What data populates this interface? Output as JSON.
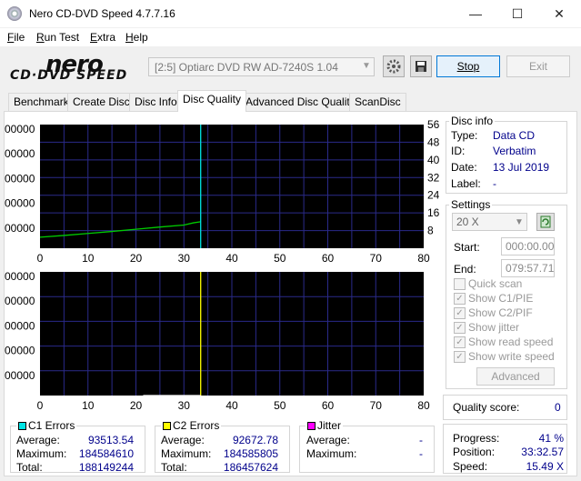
{
  "window": {
    "title": "Nero CD-DVD Speed 4.7.7.16",
    "minimize": "—",
    "maximize": "☐",
    "close": "✕"
  },
  "menu": [
    "File",
    "Run Test",
    "Extra",
    "Help"
  ],
  "logo": {
    "top": "nero",
    "bottom": "CD·DVD SPEED"
  },
  "toolbar": {
    "drive": "[2:5]   Optiarc DVD RW AD-7240S 1.04",
    "stop_label": "Stop",
    "exit_label": "Exit"
  },
  "tabs": [
    "Benchmark",
    "Create Disc",
    "Disc Info",
    "Disc Quality",
    "Advanced Disc Quality",
    "ScanDisc"
  ],
  "active_tab": "Disc Quality",
  "disc_info": {
    "title": "Disc info",
    "type_label": "Type:",
    "type": "Data CD",
    "id_label": "ID:",
    "id": "Verbatim",
    "date_label": "Date:",
    "date": "13 Jul 2019",
    "label_label": "Label:",
    "label": "-"
  },
  "settings": {
    "title": "Settings",
    "speed": "20 X",
    "start_label": "Start:",
    "start": "000:00.00",
    "end_label": "End:",
    "end": "079:57.71",
    "options": [
      {
        "label": "Quick scan",
        "checked": false
      },
      {
        "label": "Show C1/PIE",
        "checked": true
      },
      {
        "label": "Show C2/PIF",
        "checked": true
      },
      {
        "label": "Show jitter",
        "checked": true
      },
      {
        "label": "Show read speed",
        "checked": true
      },
      {
        "label": "Show write speed",
        "checked": true
      }
    ],
    "advanced_label": "Advanced"
  },
  "quality": {
    "label": "Quality score:",
    "value": "0"
  },
  "progress": {
    "progress_label": "Progress:",
    "progress": "41 %",
    "position_label": "Position:",
    "position": "33:32.57",
    "speed_label": "Speed:",
    "speed": "15.49 X"
  },
  "c1": {
    "title": "C1 Errors",
    "color": "#00e5e5",
    "average_label": "Average:",
    "average": "93513.54",
    "maximum_label": "Maximum:",
    "maximum": "184584610",
    "total_label": "Total:",
    "total": "188149244"
  },
  "c2": {
    "title": "C2 Errors",
    "color": "#ffff00",
    "average_label": "Average:",
    "average": "92672.78",
    "maximum_label": "Maximum:",
    "maximum": "184585805",
    "total_label": "Total:",
    "total": "186457624"
  },
  "jitter": {
    "title": "Jitter",
    "color": "#ff00ff",
    "average_label": "Average:",
    "average": "-",
    "maximum_label": "Maximum:",
    "maximum": "-"
  },
  "chart_data": [
    {
      "type": "line",
      "xlim": [
        0,
        80
      ],
      "x_ticks": [
        "0",
        "10",
        "20",
        "30",
        "40",
        "50",
        "60",
        "70",
        "80"
      ],
      "y_left_ticks": [
        "00000",
        "00000",
        "00000",
        "00000",
        "00000"
      ],
      "y_right_ticks": [
        "56",
        "48",
        "40",
        "32",
        "24",
        "16",
        "8"
      ],
      "ylim_right": [
        0,
        56
      ],
      "series": [
        {
          "color": "#00cc00",
          "x": [
            0,
            5,
            10,
            15,
            20,
            25,
            30,
            32,
            33.5
          ],
          "y": [
            5,
            5.8,
            6.7,
            7.6,
            8.6,
            9.6,
            10.5,
            11.5,
            12
          ]
        },
        {
          "color": "#00e5e5",
          "x": [
            33.5,
            33.5
          ],
          "y": [
            0,
            56
          ]
        }
      ],
      "grid": true
    },
    {
      "type": "line",
      "xlim": [
        0,
        80
      ],
      "x_ticks": [
        "0",
        "10",
        "20",
        "30",
        "40",
        "50",
        "60",
        "70",
        "80"
      ],
      "y_left_ticks": [
        "00000",
        "00000",
        "00000",
        "00000",
        "00000"
      ],
      "series": [
        {
          "color": "#ffff00",
          "x": [
            33.5,
            33.5
          ],
          "y": [
            0,
            1
          ]
        },
        {
          "color": "#ffffff",
          "x": [
            21.5,
            33.5
          ],
          "y": [
            0,
            0
          ]
        }
      ],
      "grid": true
    }
  ]
}
